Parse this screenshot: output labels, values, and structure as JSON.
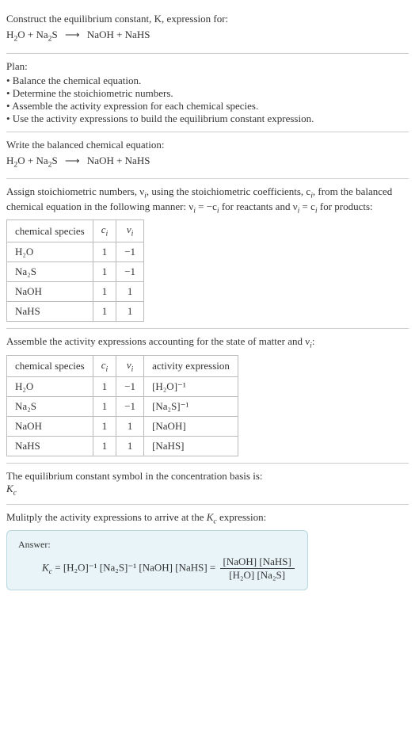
{
  "intro": {
    "line1": "Construct the equilibrium constant, K, expression for:",
    "equation_lhs1": "H",
    "equation_lhs1_sub": "2",
    "equation_lhs1b": "O + Na",
    "equation_lhs2_sub": "2",
    "equation_lhs2b": "S",
    "arrow": "⟶",
    "equation_rhs": "NaOH + NaHS"
  },
  "plan": {
    "title": "Plan:",
    "b1": "• Balance the chemical equation.",
    "b2": "• Determine the stoichiometric numbers.",
    "b3": "• Assemble the activity expression for each chemical species.",
    "b4": "• Use the activity expressions to build the equilibrium constant expression."
  },
  "balanced": {
    "title": "Write the balanced chemical equation:",
    "lhs1": "H",
    "lhs1_sub": "2",
    "lhs1b": "O + Na",
    "lhs2_sub": "2",
    "lhs2b": "S",
    "arrow": "⟶",
    "rhs": "NaOH + NaHS"
  },
  "stoich": {
    "desc1": "Assign stoichiometric numbers, ν",
    "desc1_sub": "i",
    "desc1b": ", using the stoichiometric coefficients, c",
    "desc1b_sub": "i",
    "desc1c": ", from the balanced chemical equation in the following manner: ν",
    "desc1c_sub": "i",
    "desc1d": " = −c",
    "desc1d_sub": "i",
    "desc1e": " for reactants and ν",
    "desc1e_sub": "i",
    "desc1f": " = c",
    "desc1f_sub": "i",
    "desc1g": " for products:",
    "table": {
      "h1": "chemical species",
      "h2": "c",
      "h2_sub": "i",
      "h3": "ν",
      "h3_sub": "i",
      "rows": [
        {
          "species": "H₂O",
          "c": "1",
          "v": "−1"
        },
        {
          "species": "Na₂S",
          "c": "1",
          "v": "−1"
        },
        {
          "species": "NaOH",
          "c": "1",
          "v": "1"
        },
        {
          "species": "NaHS",
          "c": "1",
          "v": "1"
        }
      ]
    }
  },
  "activity": {
    "title": "Assemble the activity expressions accounting for the state of matter and ν",
    "title_sub": "i",
    "title_end": ":",
    "table": {
      "h1": "chemical species",
      "h2": "c",
      "h2_sub": "i",
      "h3": "ν",
      "h3_sub": "i",
      "h4": "activity expression",
      "rows": [
        {
          "species": "H₂O",
          "c": "1",
          "v": "−1",
          "expr": "[H₂O]⁻¹"
        },
        {
          "species": "Na₂S",
          "c": "1",
          "v": "−1",
          "expr": "[Na₂S]⁻¹"
        },
        {
          "species": "NaOH",
          "c": "1",
          "v": "1",
          "expr": "[NaOH]"
        },
        {
          "species": "NaHS",
          "c": "1",
          "v": "1",
          "expr": "[NaHS]"
        }
      ]
    }
  },
  "symbol": {
    "line": "The equilibrium constant symbol in the concentration basis is:",
    "k": "K",
    "k_sub": "c"
  },
  "multiply": {
    "line": "Mulitply the activity expressions to arrive at the ",
    "k": "K",
    "k_sub": "c",
    "line_end": " expression:"
  },
  "answer": {
    "label": "Answer:",
    "k": "K",
    "k_sub": "c",
    "eq": " = [H₂O]⁻¹ [Na₂S]⁻¹ [NaOH] [NaHS] = ",
    "num": "[NaOH] [NaHS]",
    "den": "[H₂O] [Na₂S]"
  },
  "chart_data": {
    "type": "table",
    "tables": [
      {
        "title": "Stoichiometric numbers",
        "columns": [
          "chemical species",
          "c_i",
          "ν_i"
        ],
        "rows": [
          [
            "H₂O",
            1,
            -1
          ],
          [
            "Na₂S",
            1,
            -1
          ],
          [
            "NaOH",
            1,
            1
          ],
          [
            "NaHS",
            1,
            1
          ]
        ]
      },
      {
        "title": "Activity expressions",
        "columns": [
          "chemical species",
          "c_i",
          "ν_i",
          "activity expression"
        ],
        "rows": [
          [
            "H₂O",
            1,
            -1,
            "[H₂O]⁻¹"
          ],
          [
            "Na₂S",
            1,
            -1,
            "[Na₂S]⁻¹"
          ],
          [
            "NaOH",
            1,
            1,
            "[NaOH]"
          ],
          [
            "NaHS",
            1,
            1,
            "[NaHS]"
          ]
        ]
      }
    ]
  }
}
